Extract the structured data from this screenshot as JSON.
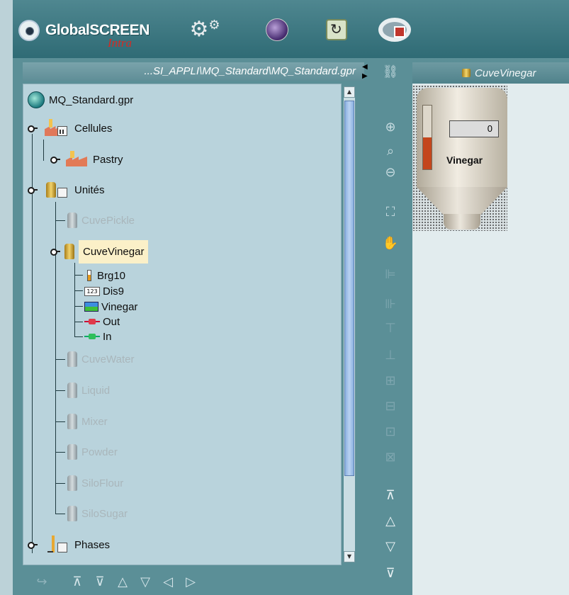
{
  "app": {
    "logo_text": "GlobalSCREEN",
    "logo_sub": "Intra"
  },
  "path_bar": "...SI_APPLI\\MQ_Standard\\MQ_Standard.gpr",
  "tree": {
    "root": "MQ_Standard.gpr",
    "cellules": "Cellules",
    "pastry": "Pastry",
    "unites": "Unités",
    "cuve_pickle": "CuvePickle",
    "cuve_vinegar": "CuveVinegar",
    "brg10": "Brg10",
    "dis9": "Dis9",
    "vinegar": "Vinegar",
    "out": "Out",
    "in": "In",
    "cuve_water": "CuveWater",
    "liquid": "Liquid",
    "mixer": "Mixer",
    "powder": "Powder",
    "silo_flour": "SiloFlour",
    "silo_sugar": "SiloSugar",
    "phases": "Phases",
    "dis_icon_text": "123"
  },
  "document_tab": {
    "title": "CuveVinegar"
  },
  "tank_widget": {
    "display_value": "0",
    "label": "Vinegar",
    "level_fraction": 0.5
  },
  "icons": {
    "zoom_in": "zoom-in-icon",
    "zoom_fit": "zoom-fit-icon",
    "zoom_out": "zoom-out-icon",
    "fullscreen": "fullscreen-icon",
    "hand": "hand-icon",
    "link": "link-icon"
  },
  "colors": {
    "frame": "#5b8f97",
    "tree_bg": "#b9d3dc",
    "selected": "#fbf0c8",
    "level": "#c4461c",
    "disabled_text": "#a9b6bb"
  }
}
